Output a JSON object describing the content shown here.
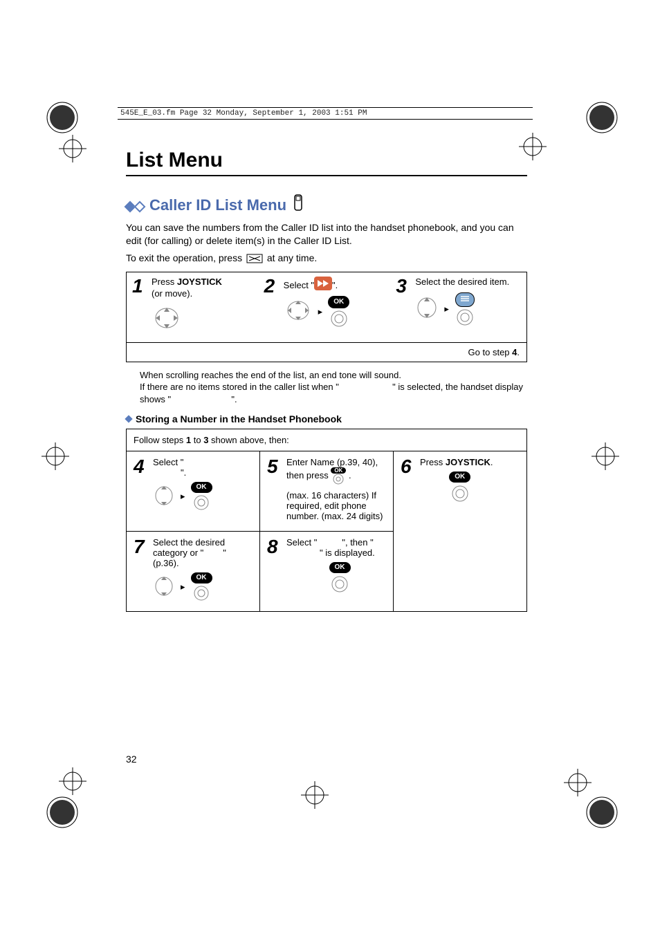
{
  "header_bar": "545E_E_03.fm  Page 32  Monday, September 1, 2003  1:51 PM",
  "page_title": "List Menu",
  "section_title": "Caller ID List Menu",
  "intro_line1": "You can save the numbers from the Caller ID list into the handset phonebook, and you can edit (for calling) or delete item(s) in the Caller ID List.",
  "intro_line2_prefix": "To exit the operation, press ",
  "intro_line2_suffix": " at any time.",
  "steps13": {
    "s1": {
      "prefix": "Press ",
      "bold": "JOYSTICK",
      "line2": "(or move)."
    },
    "s2": {
      "prefix": "Select \"",
      "suffix": "\"."
    },
    "s3": {
      "text": "Select the desired item."
    },
    "goto": "Go to step ",
    "goto_num": "4",
    "goto_tail": "."
  },
  "bullet_note_l1": "When scrolling reaches the end of the list, an end tone will sound.",
  "bullet_note_l2_a": "If there are no items stored in the caller list when \"",
  "bullet_note_l2_b": "\" is selected, the handset display shows \"",
  "bullet_note_l2_c": "\".",
  "sub_heading": "Storing a Number in the Handset Phonebook",
  "follow": {
    "a": "Follow steps ",
    "b": "1",
    "c": " to ",
    "d": "3",
    "e": " shown above, then:"
  },
  "step4": {
    "a": "Select \"",
    "b": "\"."
  },
  "step5": {
    "a": "Enter Name (p.39, 40), then press ",
    "b": ".",
    "note": "(max. 16 characters) If required, edit phone number. (max. 24 digits)"
  },
  "step6": {
    "a": "Press ",
    "bold": "JOYSTICK",
    "c": "."
  },
  "step7": {
    "a": "Select the desired category or \"",
    "b": "\" (p.36)."
  },
  "step8": {
    "a": "Select \"",
    "b": "\", then \"",
    "c": "\" is displayed."
  },
  "ok_label": "OK",
  "page_number": "32"
}
